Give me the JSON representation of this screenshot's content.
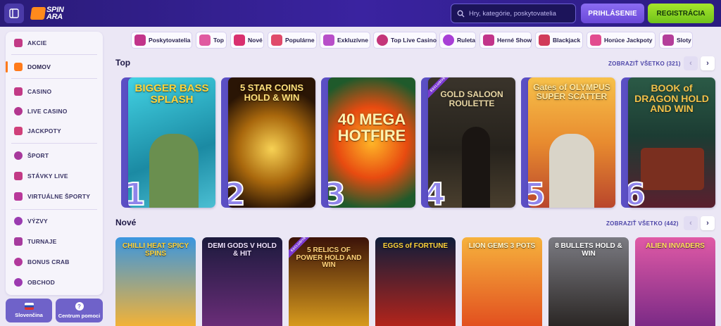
{
  "header": {
    "search_placeholder": "Hry, kategórie, poskytovatelia",
    "login_label": "PRIHLÁSENIE",
    "register_label": "REGISTRÁCIA",
    "logo_line1": "SPIN",
    "logo_line2": "ARA"
  },
  "sidebar": {
    "items": [
      {
        "label": "AKCIE",
        "icon": "gift-icon"
      },
      {
        "label": "DOMOV",
        "icon": "home-icon"
      },
      {
        "label": "CASINO",
        "icon": "slot-icon"
      },
      {
        "label": "LIVE CASINO",
        "icon": "roulette-icon"
      },
      {
        "label": "JACKPOTY",
        "icon": "jackpot-icon"
      },
      {
        "label": "ŠPORT",
        "icon": "ball-icon"
      },
      {
        "label": "STÁVKY LIVE",
        "icon": "live-bet-icon"
      },
      {
        "label": "VIRTUÁLNE ŠPORTY",
        "icon": "virtual-sport-icon"
      },
      {
        "label": "VÝZVY",
        "icon": "challenge-icon"
      },
      {
        "label": "TURNAJE",
        "icon": "trophy-icon"
      },
      {
        "label": "BONUS CRAB",
        "icon": "crab-icon"
      },
      {
        "label": "OBCHOD",
        "icon": "shop-icon"
      }
    ],
    "language_label": "Slovenčina",
    "help_label": "Centrum pomoci"
  },
  "categories": [
    {
      "label": "Poskytovatelia",
      "icon": "providers-icon",
      "color": "#c2348a"
    },
    {
      "label": "Top",
      "icon": "crown-icon",
      "color": "#e05aa0"
    },
    {
      "label": "Nové",
      "icon": "lightning-icon",
      "color": "#d9306f"
    },
    {
      "label": "Populárne",
      "icon": "flame-icon",
      "color": "#e04a6a"
    },
    {
      "label": "Exkluzívne",
      "icon": "diamond-icon",
      "color": "#b84fc9"
    },
    {
      "label": "Top Live Casino",
      "icon": "live-chip-icon",
      "color": "#c43579"
    },
    {
      "label": "Ruleta",
      "icon": "roulette-wheel-icon",
      "color": "#a83fd6"
    },
    {
      "label": "Herné Show",
      "icon": "microphone-icon",
      "color": "#c2348a"
    },
    {
      "label": "Blackjack",
      "icon": "cards-icon",
      "color": "#d13b5a"
    },
    {
      "label": "Horúce Jackpoty",
      "icon": "hot-jackpot-icon",
      "color": "#e24b8f"
    },
    {
      "label": "Sloty",
      "icon": "slot-machine-icon",
      "color": "#b43e9a"
    }
  ],
  "top_section": {
    "title": "Top",
    "show_all": "ZOBRAZIŤ VŠETKO (321)",
    "games": [
      {
        "rank": "1",
        "title": "BIGGER BASS SPLASH",
        "exclusive": false,
        "color_a": "#2fc3d6",
        "color_b": "#1b8aa3"
      },
      {
        "rank": "2",
        "title": "5 STAR COINS HOLD & WIN",
        "exclusive": false,
        "color_a": "#3a1e08",
        "color_b": "#e6a91e"
      },
      {
        "rank": "3",
        "title": "40 MEGA HOTFIRE",
        "exclusive": false,
        "color_a": "#1b5e2a",
        "color_b": "#f26b11"
      },
      {
        "rank": "4",
        "title": "GOLD SALOON ROULETTE",
        "exclusive": true,
        "exclusive_label": "EXCLUSIVE",
        "color_a": "#2b2721",
        "color_b": "#6a5c43"
      },
      {
        "rank": "5",
        "title": "Gates of OLYMPUS SUPER SCATTER",
        "exclusive": false,
        "color_a": "#f3b23a",
        "color_b": "#c2652a"
      },
      {
        "rank": "6",
        "title": "BOOK of DRAGON HOLD AND WIN",
        "exclusive": false,
        "color_a": "#1f4b3d",
        "color_b": "#4c1f2c"
      }
    ]
  },
  "new_section": {
    "title": "Nové",
    "show_all": "ZOBRAZIŤ VŠETKO (442)",
    "games": [
      {
        "title": "CHILLI HEAT SPICY SPINS",
        "exclusive": false,
        "color_a": "#2f86d8",
        "color_b": "#f2b237"
      },
      {
        "title": "DEMI GODS V HOLD & HIT",
        "exclusive": false,
        "color_a": "#1c1a3d",
        "color_b": "#6a2d78"
      },
      {
        "title": "5 RELICS OF POWER HOLD AND WIN",
        "exclusive": true,
        "exclusive_label": "EXCLUSIVE",
        "color_a": "#3b1208",
        "color_b": "#d79a1d"
      },
      {
        "title": "EGGS of FORTUNE",
        "exclusive": false,
        "color_a": "#0f1d3a",
        "color_b": "#b3241b"
      },
      {
        "title": "LION GEMS 3 POTS",
        "exclusive": false,
        "color_a": "#f6b23d",
        "color_b": "#e2501f"
      },
      {
        "title": "8 BULLETS HOLD & WIN",
        "exclusive": false,
        "color_a": "#6b6b70",
        "color_b": "#2b2725"
      },
      {
        "title": "ALIEN INVADERS",
        "exclusive": false,
        "color_a": "#d94b9a",
        "color_b": "#7b2a86"
      }
    ]
  },
  "colors": {
    "header_bg": "#2a1b78",
    "accent_orange": "#ff7a1a",
    "register_green": "#8ad624",
    "login_purple": "#7a5ae5"
  }
}
